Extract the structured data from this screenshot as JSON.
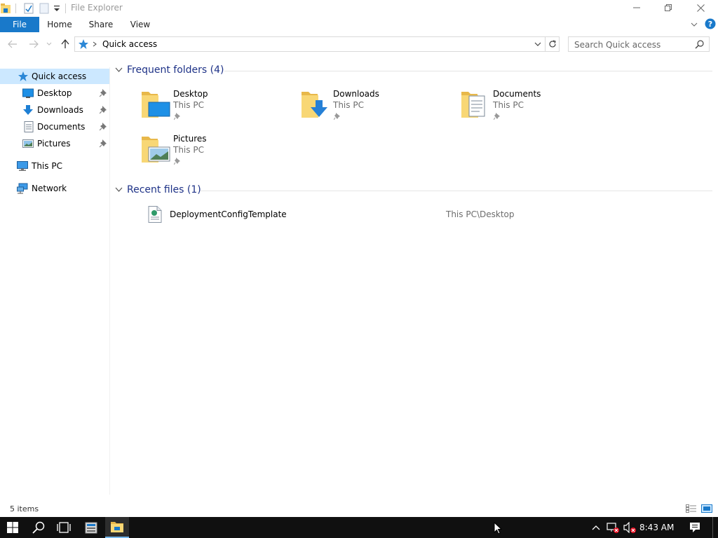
{
  "window": {
    "title": "File Explorer"
  },
  "ribbon": {
    "tabs": [
      "File",
      "Home",
      "Share",
      "View"
    ]
  },
  "address": {
    "location": "Quick access"
  },
  "search": {
    "placeholder": "Search Quick access"
  },
  "nav": {
    "items": [
      {
        "label": "Quick access",
        "icon": "star-icon"
      },
      {
        "label": "Desktop",
        "icon": "desktop-icon",
        "pinned": true
      },
      {
        "label": "Downloads",
        "icon": "download-arrow-icon",
        "pinned": true
      },
      {
        "label": "Documents",
        "icon": "document-icon",
        "pinned": true
      },
      {
        "label": "Pictures",
        "icon": "picture-icon",
        "pinned": true
      },
      {
        "label": "This PC",
        "icon": "computer-icon"
      },
      {
        "label": "Network",
        "icon": "network-icon"
      }
    ]
  },
  "frequent": {
    "header": "Frequent folders (4)",
    "folders": [
      {
        "name": "Desktop",
        "location": "This PC",
        "icon": "desktop-folder-icon"
      },
      {
        "name": "Downloads",
        "location": "This PC",
        "icon": "downloads-folder-icon"
      },
      {
        "name": "Documents",
        "location": "This PC",
        "icon": "documents-folder-icon"
      },
      {
        "name": "Pictures",
        "location": "This PC",
        "icon": "pictures-folder-icon"
      }
    ]
  },
  "recent": {
    "header": "Recent files (1)",
    "files": [
      {
        "name": "DeploymentConfigTemplate",
        "path": "This PC\\Desktop",
        "icon": "config-file-icon"
      }
    ]
  },
  "status": {
    "count": "5 items"
  },
  "taskbar": {
    "clock": "8:43 AM"
  },
  "colors": {
    "accent": "#1979ca",
    "selection": "#cce8ff",
    "group_header": "#1e3287",
    "taskbar": "#101010",
    "folder": "#f8d775"
  }
}
